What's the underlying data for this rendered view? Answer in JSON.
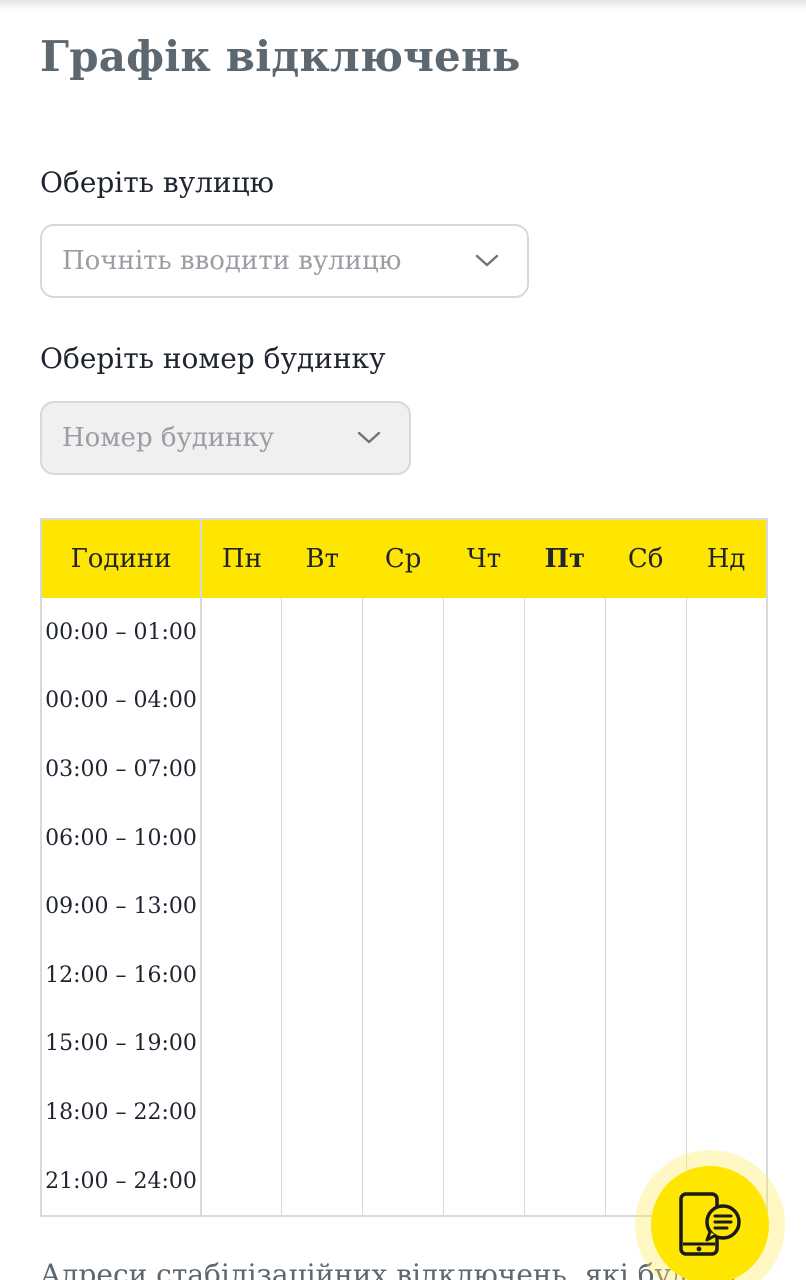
{
  "page": {
    "title": "Графік відключень"
  },
  "street": {
    "label": "Оберіть вулицю",
    "placeholder": "Почніть вводити вулицю"
  },
  "house": {
    "label": "Оберіть номер будинку",
    "placeholder": "Номер будинку"
  },
  "schedule": {
    "hours_header": "Години",
    "days": [
      "Пн",
      "Вт",
      "Ср",
      "Чт",
      "Пт",
      "Сб",
      "Нд"
    ],
    "today": "Пт",
    "time_slots": [
      "00:00 – 01:00",
      "00:00 – 04:00",
      "03:00 – 07:00",
      "06:00 – 10:00",
      "09:00 – 13:00",
      "12:00 – 16:00",
      "15:00 – 19:00",
      "18:00 – 22:00",
      "21:00 – 24:00"
    ]
  },
  "footer": {
    "text": "Адреси стабілізаційних відключень, які будуть"
  },
  "chat": {
    "icon": "phone-chat-icon",
    "color": "#ffe600"
  },
  "colors": {
    "accent_yellow": "#ffe600",
    "title_gray": "#5d6770",
    "border": "#d9d9d9"
  }
}
